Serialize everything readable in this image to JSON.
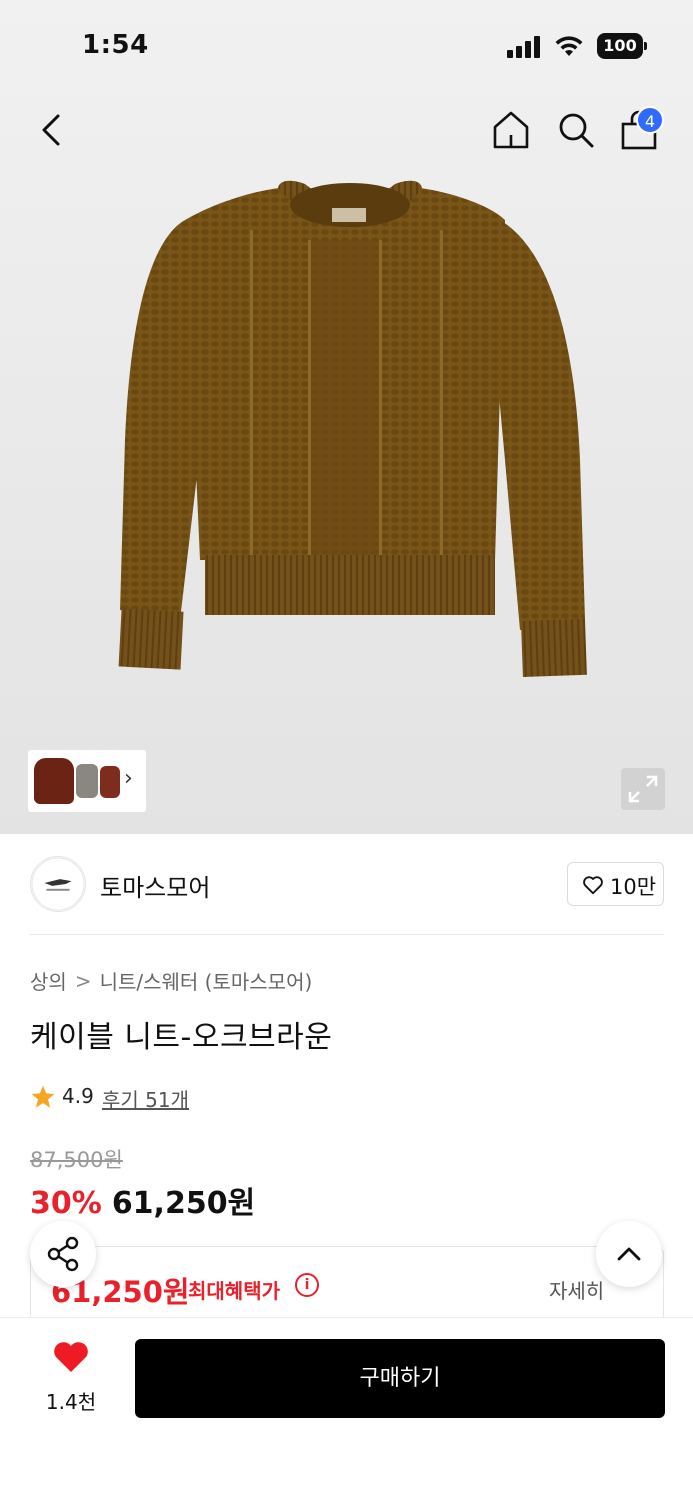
{
  "status_bar": {
    "time": "1:54",
    "battery": "100"
  },
  "header": {
    "cart_count": "4"
  },
  "brand": {
    "name": "토마스모어",
    "likes": "10만"
  },
  "breadcrumb": {
    "category": "상의",
    "subcategory": "니트/스웨터 (토마스모어)"
  },
  "product": {
    "title": "케이블 니트-오크브라운",
    "rating": "4.9",
    "reviews": "후기 51개",
    "original_price": "87,500원",
    "discount": "30%",
    "price": "61,250원"
  },
  "benefit": {
    "price": "61,250원",
    "label": "최대혜택가",
    "info_symbol": "i",
    "detail": "자세히"
  },
  "bottom_bar": {
    "wish_count": "1.4천",
    "buy_label": "구매하기"
  },
  "colors": {
    "accent_red": "#e8212a",
    "badge_blue": "#2f6bff",
    "sweater_brown": "#7a5518",
    "thumb_brown": "#6b2414"
  },
  "icons": [
    "back-arrow-icon",
    "home-icon",
    "search-icon",
    "shopping-bag-icon",
    "chevron-right-icon",
    "expand-icon",
    "heart-outline-icon",
    "star-icon",
    "info-icon",
    "share-icon",
    "chevron-up-icon",
    "heart-filled-icon"
  ]
}
